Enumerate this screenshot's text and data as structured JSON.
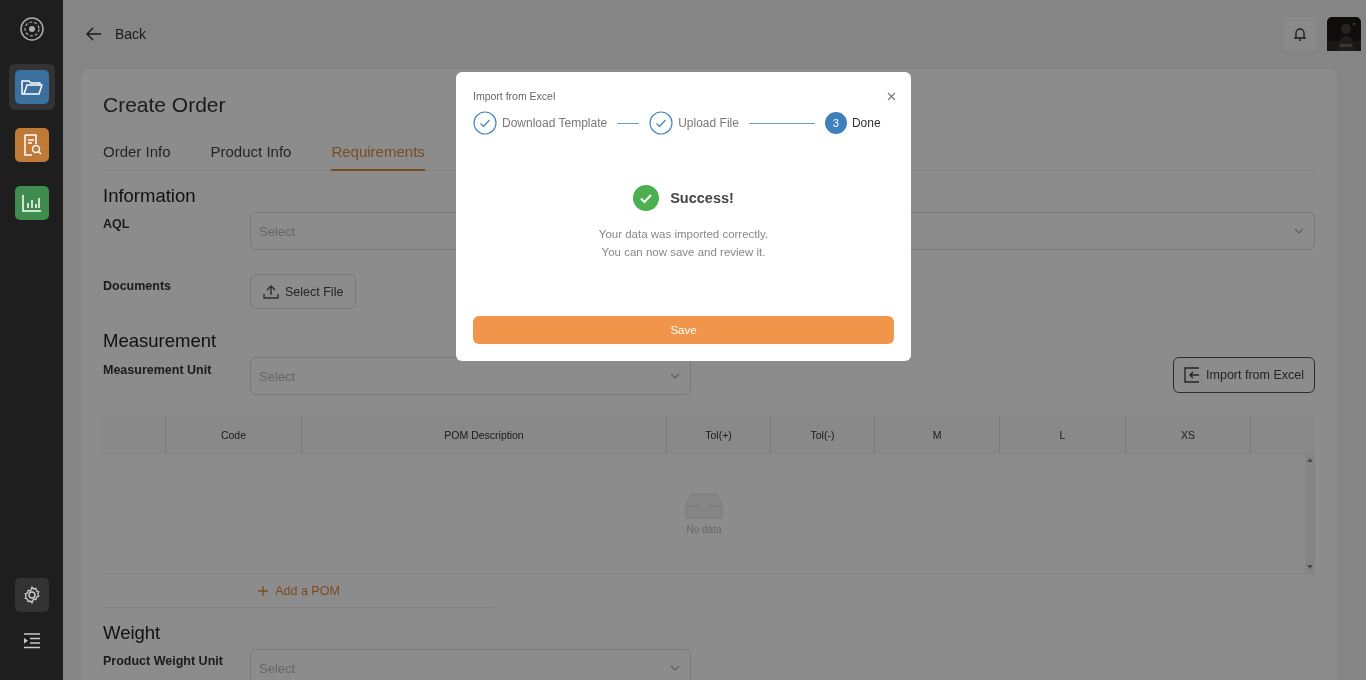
{
  "sidebar": {
    "items": [
      {
        "kind": "folder",
        "color": "#3b6f9e",
        "selected": true
      },
      {
        "kind": "report",
        "color": "#c07a38",
        "selected": false
      },
      {
        "kind": "chart",
        "color": "#3f8c4e",
        "selected": false
      }
    ],
    "bottom": [
      {
        "kind": "settings",
        "selected": true
      },
      {
        "kind": "menu",
        "selected": false
      }
    ]
  },
  "header": {
    "back": "Back"
  },
  "page": {
    "title": "Create Order",
    "tabs": [
      {
        "label": "Order Info",
        "selected": false
      },
      {
        "label": "Product Info",
        "selected": false
      },
      {
        "label": "Requirements",
        "selected": true
      }
    ],
    "information": {
      "heading": "Information",
      "aql_label": "AQL",
      "aql_placeholder": "Select",
      "documents_label": "Documents",
      "select_file": "Select File"
    },
    "measurement": {
      "heading": "Measurement",
      "unit_label": "Measurement Unit",
      "unit_placeholder": "Select",
      "import_button": "Import from Excel"
    },
    "table": {
      "columns": [
        "Code",
        "POM Description",
        "Tol(+)",
        "Tol(-)",
        "M",
        "L",
        "XS"
      ],
      "empty_text": "No data"
    },
    "add_pom": "Add a POM",
    "weight": {
      "heading": "Weight",
      "unit_label": "Product Weight Unit",
      "unit_placeholder": "Select"
    }
  },
  "modal": {
    "title": "Import from Excel",
    "steps": [
      {
        "label": "Download Template",
        "done": true
      },
      {
        "label": "Upload File",
        "done": true
      },
      {
        "label": "Done",
        "done": false,
        "number": "3"
      }
    ],
    "result_title": "Success!",
    "message_lines": [
      "Your data was imported correctly.",
      "You can now save and review it."
    ],
    "save": "Save"
  }
}
